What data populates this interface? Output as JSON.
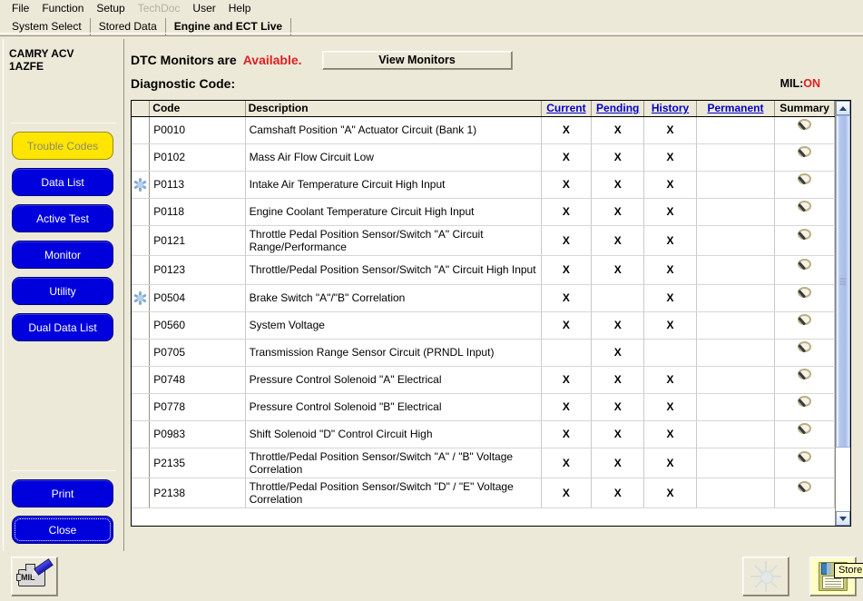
{
  "menu": {
    "items": [
      {
        "label": "File",
        "disabled": false
      },
      {
        "label": "Function",
        "disabled": false
      },
      {
        "label": "Setup",
        "disabled": false
      },
      {
        "label": "TechDoc",
        "disabled": true
      },
      {
        "label": "User",
        "disabled": false
      },
      {
        "label": "Help",
        "disabled": false
      }
    ]
  },
  "tabs": [
    {
      "label": "System Select",
      "active": false
    },
    {
      "label": "Stored Data",
      "active": false
    },
    {
      "label": "Engine and ECT Live",
      "active": true
    }
  ],
  "sidebar": {
    "vehicle": "CAMRY ACV\n1AZFE",
    "nav": [
      {
        "label": "Trouble Codes",
        "state": "selected"
      },
      {
        "label": "Data List",
        "state": "normal"
      },
      {
        "label": "Active Test",
        "state": "normal"
      },
      {
        "label": "Monitor",
        "state": "normal"
      },
      {
        "label": "Utility",
        "state": "normal"
      },
      {
        "label": "Dual Data List",
        "state": "normal"
      }
    ],
    "bottom": [
      {
        "label": "Print",
        "state": "normal"
      },
      {
        "label": "Close",
        "state": "focus"
      }
    ]
  },
  "header": {
    "dtc_monitors_label": "DTC Monitors are",
    "dtc_monitors_value": "Available.",
    "view_monitors_label": "View Monitors",
    "diagnostic_code_label": "Diagnostic Code:",
    "mil_label": "MIL:",
    "mil_value": "ON"
  },
  "colors": {
    "accent_red": "#e02020",
    "link_blue": "#0000cc",
    "nav_blue": "#0000dd",
    "nav_selected_yellow": "#ffe500",
    "window_bg": "#ece9d8"
  },
  "grid": {
    "columns": [
      {
        "label": "",
        "type": "indicator"
      },
      {
        "label": "Code",
        "type": "text"
      },
      {
        "label": "Description",
        "type": "text"
      },
      {
        "label": "Current",
        "type": "link"
      },
      {
        "label": "Pending",
        "type": "link"
      },
      {
        "label": "History",
        "type": "link"
      },
      {
        "label": "Permanent",
        "type": "link"
      },
      {
        "label": "Summary",
        "type": "plain"
      }
    ],
    "mark": "X",
    "summary_icon": "magnifier-icon",
    "freeze_icon": "snowflake-icon",
    "rows": [
      {
        "freeze": false,
        "code": "P0010",
        "description": "Camshaft Position \"A\" Actuator Circuit (Bank 1)",
        "current": "X",
        "pending": "X",
        "history": "X",
        "permanent": "",
        "summary": "magnifier-icon"
      },
      {
        "freeze": false,
        "code": "P0102",
        "description": "Mass Air Flow Circuit Low",
        "current": "X",
        "pending": "X",
        "history": "X",
        "permanent": "",
        "summary": "magnifier-icon"
      },
      {
        "freeze": true,
        "code": "P0113",
        "description": "Intake Air Temperature Circuit High Input",
        "current": "X",
        "pending": "X",
        "history": "X",
        "permanent": "",
        "summary": "magnifier-icon"
      },
      {
        "freeze": false,
        "code": "P0118",
        "description": "Engine Coolant Temperature Circuit High Input",
        "current": "X",
        "pending": "X",
        "history": "X",
        "permanent": "",
        "summary": "magnifier-icon"
      },
      {
        "freeze": false,
        "code": "P0121",
        "description": "Throttle Pedal Position Sensor/Switch \"A\" Circuit Range/Performance",
        "current": "X",
        "pending": "X",
        "history": "X",
        "permanent": "",
        "summary": "magnifier-icon"
      },
      {
        "freeze": false,
        "code": "P0123",
        "description": "Throttle/Pedal Position Sensor/Switch \"A\" Circuit High Input",
        "current": "X",
        "pending": "X",
        "history": "X",
        "permanent": "",
        "summary": "magnifier-icon"
      },
      {
        "freeze": true,
        "code": "P0504",
        "description": "Brake Switch \"A\"/\"B\" Correlation",
        "current": "X",
        "pending": "",
        "history": "X",
        "permanent": "",
        "summary": "magnifier-icon"
      },
      {
        "freeze": false,
        "code": "P0560",
        "description": "System Voltage",
        "current": "X",
        "pending": "X",
        "history": "X",
        "permanent": "",
        "summary": "magnifier-icon"
      },
      {
        "freeze": false,
        "code": "P0705",
        "description": "Transmission Range Sensor Circuit (PRNDL Input)",
        "current": "",
        "pending": "X",
        "history": "",
        "permanent": "",
        "summary": "magnifier-icon"
      },
      {
        "freeze": false,
        "code": "P0748",
        "description": "Pressure Control Solenoid \"A\" Electrical",
        "current": "X",
        "pending": "X",
        "history": "X",
        "permanent": "",
        "summary": "magnifier-icon"
      },
      {
        "freeze": false,
        "code": "P0778",
        "description": "Pressure Control Solenoid \"B\" Electrical",
        "current": "X",
        "pending": "X",
        "history": "X",
        "permanent": "",
        "summary": "magnifier-icon"
      },
      {
        "freeze": false,
        "code": "P0983",
        "description": "Shift Solenoid \"D\" Control Circuit High",
        "current": "X",
        "pending": "X",
        "history": "X",
        "permanent": "",
        "summary": "magnifier-icon"
      },
      {
        "freeze": false,
        "code": "P2135",
        "description": "Throttle/Pedal Position Sensor/Switch \"A\" / \"B\" Voltage Correlation",
        "current": "X",
        "pending": "X",
        "history": "X",
        "permanent": "",
        "summary": "magnifier-icon"
      },
      {
        "freeze": false,
        "code": "P2138",
        "description": "Throttle/Pedal Position Sensor/Switch \"D\" / \"E\" Voltage Correlation",
        "current": "X",
        "pending": "X",
        "history": "X",
        "permanent": "",
        "summary": "magnifier-icon"
      }
    ]
  },
  "toolbar": {
    "mil_button_icon": "engine-mil-icon",
    "snowshot_button_icon": "snowflake-icon",
    "store_button_icon": "floppy-disk-icon",
    "store_tooltip": "Store"
  }
}
